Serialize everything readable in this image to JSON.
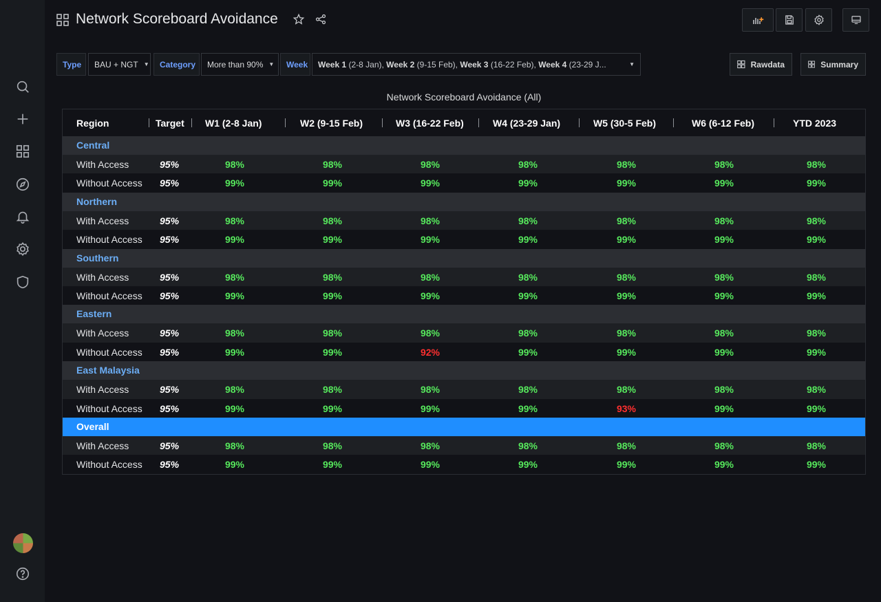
{
  "header": {
    "title": "Network Scoreboard Avoidance"
  },
  "variables": {
    "type_label": "Type",
    "type_value": "BAU + NGT",
    "category_label": "Category",
    "category_value": "More than 90%",
    "week_label": "Week",
    "week_value_parts": [
      {
        "bold": "Week 1",
        "rest": " (2-8 Jan), "
      },
      {
        "bold": "Week 2",
        "rest": " (9-15 Feb), "
      },
      {
        "bold": "Week 3",
        "rest": " (16-22 Feb), "
      },
      {
        "bold": "Week 4",
        "rest": " (23-29 J..."
      }
    ],
    "rawdata_label": "Rawdata",
    "summary_label": "Summary"
  },
  "panel": {
    "title": "Network Scoreboard Avoidance (All)",
    "columns": [
      "Region",
      "Target",
      "W1 (2-8 Jan)",
      "W2 (9-15 Feb)",
      "W3 (16-22 Feb)",
      "W4 (23-29 Jan)",
      "W5 (30-5 Feb)",
      "W6 (6-12 Feb)",
      "YTD 2023"
    ],
    "regions": [
      {
        "name": "Central",
        "overall": false,
        "rows": [
          {
            "label": "With Access",
            "target": "95%",
            "values": [
              "98%",
              "98%",
              "98%",
              "98%",
              "98%",
              "98%",
              "98%"
            ],
            "bad": [
              false,
              false,
              false,
              false,
              false,
              false,
              false
            ]
          },
          {
            "label": "Without Access",
            "target": "95%",
            "values": [
              "99%",
              "99%",
              "99%",
              "99%",
              "99%",
              "99%",
              "99%"
            ],
            "bad": [
              false,
              false,
              false,
              false,
              false,
              false,
              false
            ]
          }
        ]
      },
      {
        "name": "Northern",
        "overall": false,
        "rows": [
          {
            "label": "With Access",
            "target": "95%",
            "values": [
              "98%",
              "98%",
              "98%",
              "98%",
              "98%",
              "98%",
              "98%"
            ],
            "bad": [
              false,
              false,
              false,
              false,
              false,
              false,
              false
            ]
          },
          {
            "label": "Without Access",
            "target": "95%",
            "values": [
              "99%",
              "99%",
              "99%",
              "99%",
              "99%",
              "99%",
              "99%"
            ],
            "bad": [
              false,
              false,
              false,
              false,
              false,
              false,
              false
            ]
          }
        ]
      },
      {
        "name": "Southern",
        "overall": false,
        "rows": [
          {
            "label": "With Access",
            "target": "95%",
            "values": [
              "98%",
              "98%",
              "98%",
              "98%",
              "98%",
              "98%",
              "98%"
            ],
            "bad": [
              false,
              false,
              false,
              false,
              false,
              false,
              false
            ]
          },
          {
            "label": "Without Access",
            "target": "95%",
            "values": [
              "99%",
              "99%",
              "99%",
              "99%",
              "99%",
              "99%",
              "99%"
            ],
            "bad": [
              false,
              false,
              false,
              false,
              false,
              false,
              false
            ]
          }
        ]
      },
      {
        "name": "Eastern",
        "overall": false,
        "rows": [
          {
            "label": "With Access",
            "target": "95%",
            "values": [
              "98%",
              "98%",
              "98%",
              "98%",
              "98%",
              "98%",
              "98%"
            ],
            "bad": [
              false,
              false,
              false,
              false,
              false,
              false,
              false
            ]
          },
          {
            "label": "Without Access",
            "target": "95%",
            "values": [
              "99%",
              "99%",
              "92%",
              "99%",
              "99%",
              "99%",
              "99%"
            ],
            "bad": [
              false,
              false,
              true,
              false,
              false,
              false,
              false
            ]
          }
        ]
      },
      {
        "name": "East Malaysia",
        "overall": false,
        "rows": [
          {
            "label": "With Access",
            "target": "95%",
            "values": [
              "98%",
              "98%",
              "98%",
              "98%",
              "98%",
              "98%",
              "98%"
            ],
            "bad": [
              false,
              false,
              false,
              false,
              false,
              false,
              false
            ]
          },
          {
            "label": "Without Access",
            "target": "95%",
            "values": [
              "99%",
              "99%",
              "99%",
              "99%",
              "93%",
              "99%",
              "99%"
            ],
            "bad": [
              false,
              false,
              false,
              false,
              true,
              false,
              false
            ]
          }
        ]
      },
      {
        "name": "Overall",
        "overall": true,
        "rows": [
          {
            "label": "With Access",
            "target": "95%",
            "values": [
              "98%",
              "98%",
              "98%",
              "98%",
              "98%",
              "98%",
              "98%"
            ],
            "bad": [
              false,
              false,
              false,
              false,
              false,
              false,
              false
            ]
          },
          {
            "label": "Without Access",
            "target": "95%",
            "values": [
              "99%",
              "99%",
              "99%",
              "99%",
              "99%",
              "99%",
              "99%"
            ],
            "bad": [
              false,
              false,
              false,
              false,
              false,
              false,
              false
            ]
          }
        ]
      }
    ]
  },
  "colors": {
    "good": "#56e85c",
    "bad": "#ff2f2f",
    "region_header": "#6caef6",
    "overall_bg": "#1f8eff"
  }
}
